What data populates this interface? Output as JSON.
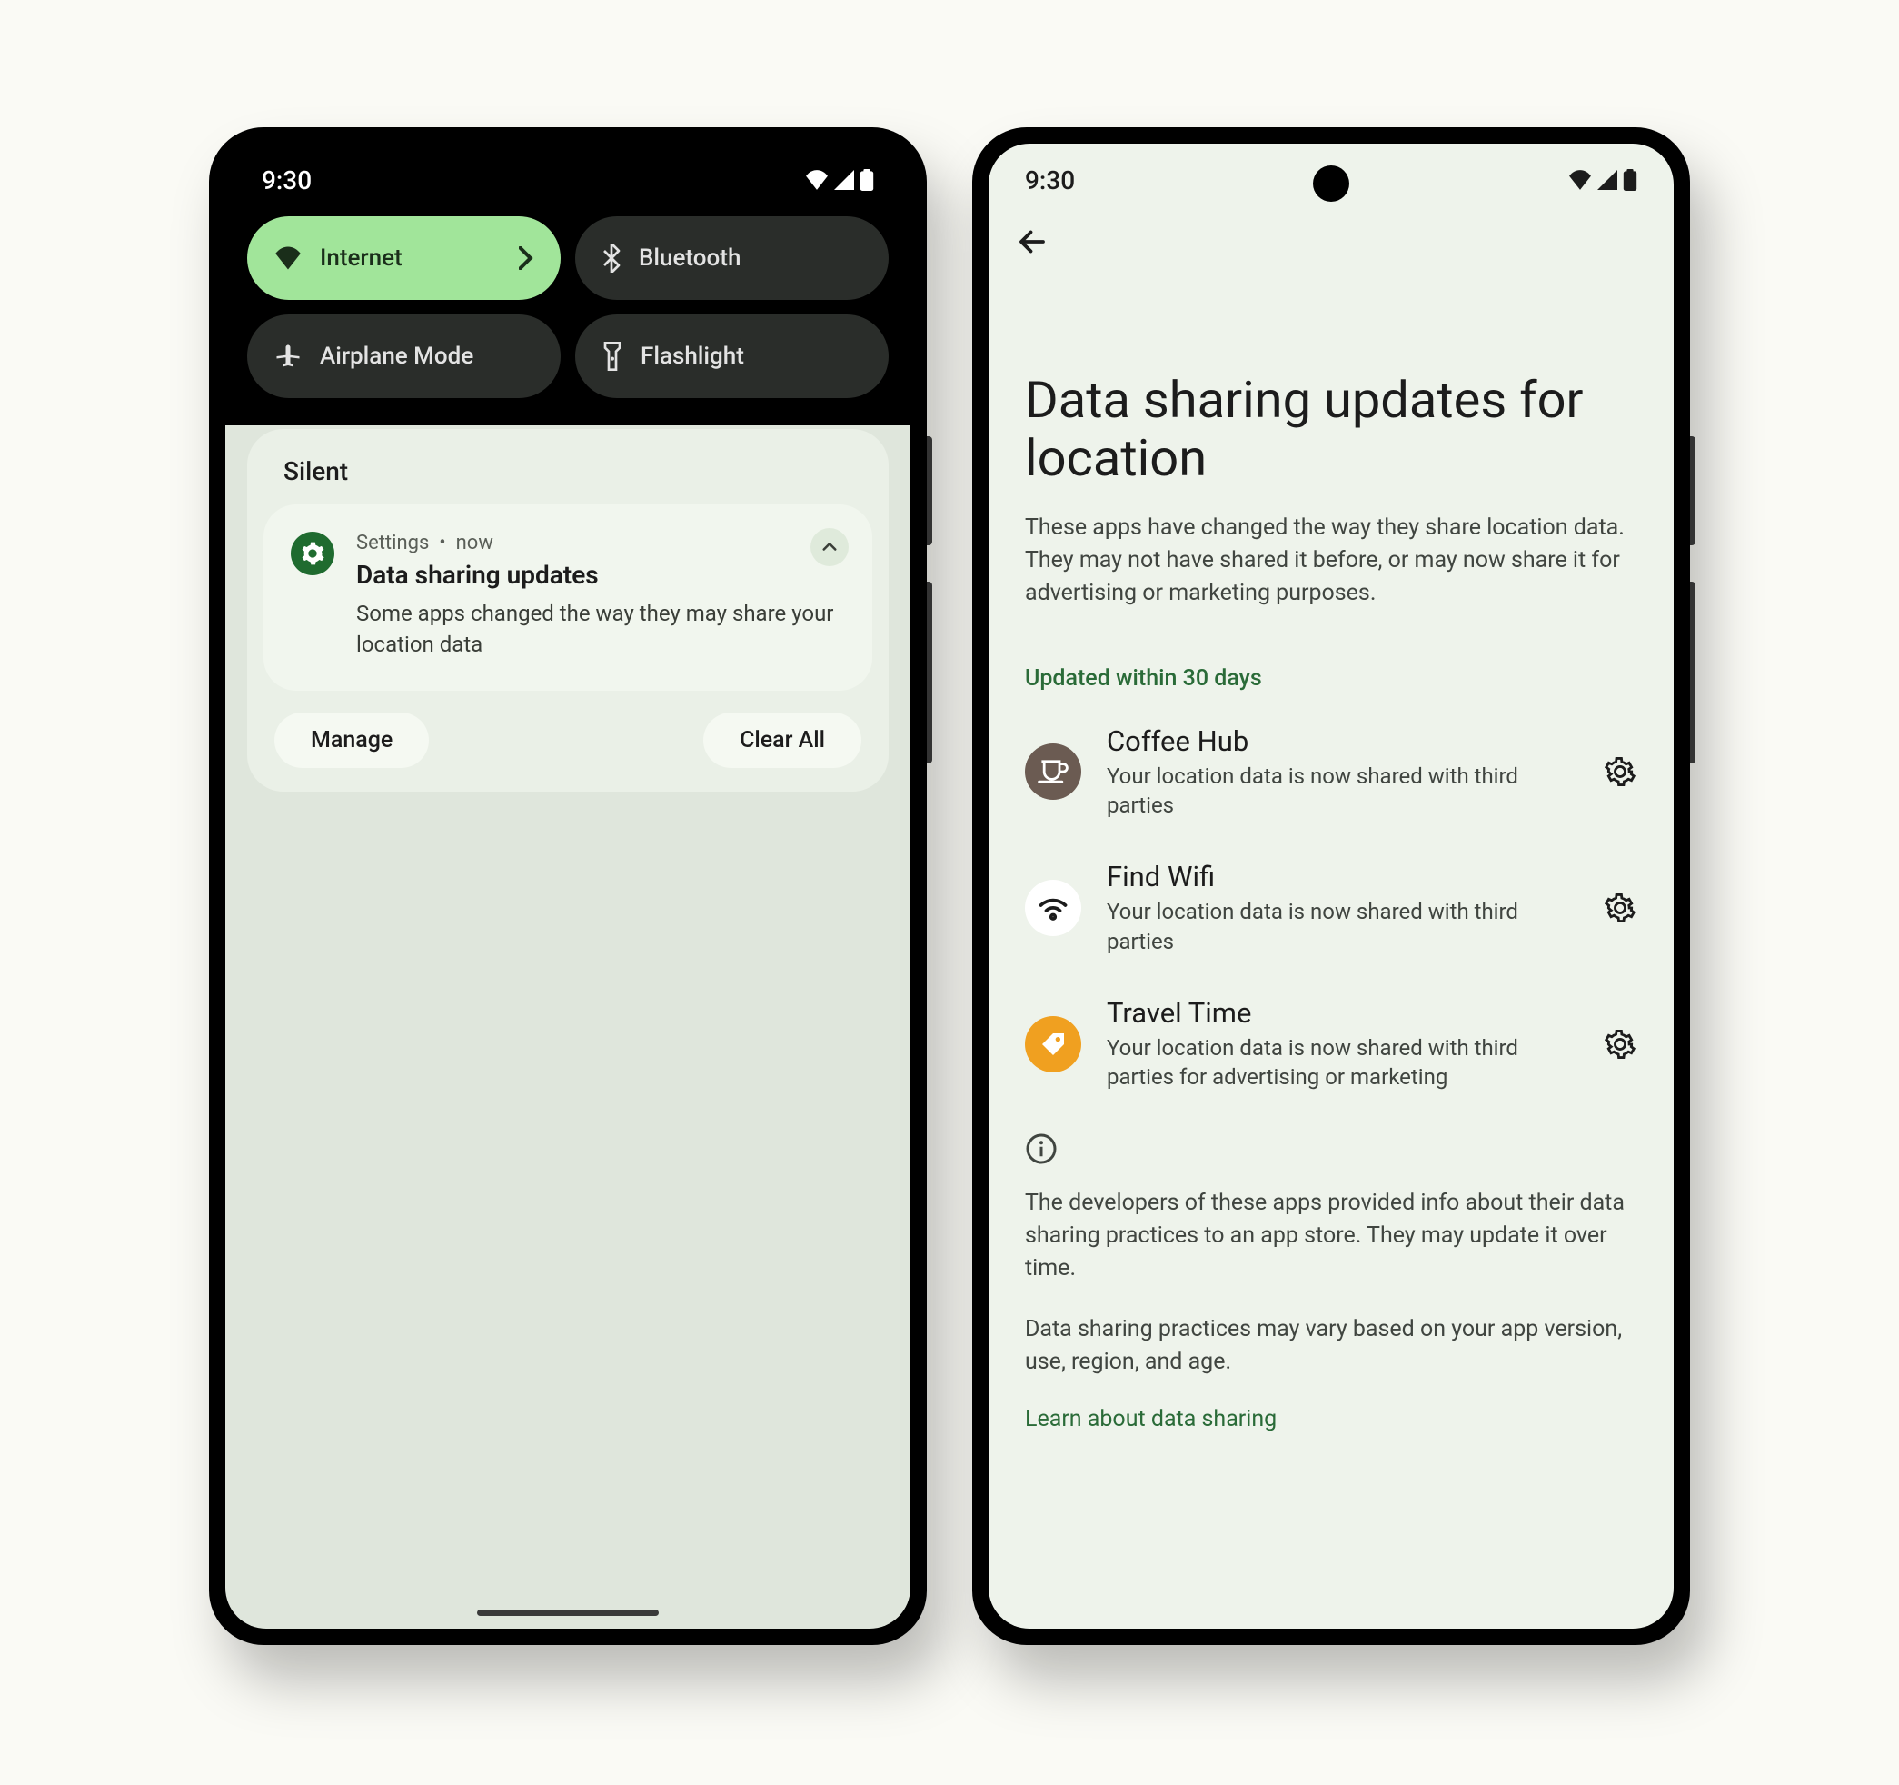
{
  "phone1": {
    "statusTime": "9:30",
    "qs": {
      "internet": "Internet",
      "bluetooth": "Bluetooth",
      "airplane": "Airplane Mode",
      "flashlight": "Flashlight"
    },
    "silentLabel": "Silent",
    "notif": {
      "source": "Settings",
      "time": "now",
      "sep": "•",
      "title": "Data sharing updates",
      "body": "Some apps changed the way they may share your location data"
    },
    "manage": "Manage",
    "clearAll": "Clear All"
  },
  "phone2": {
    "statusTime": "9:30",
    "title": "Data sharing updates for location",
    "subtitle": "These apps have changed the way they share location data. They may not have shared it before, or may now share it for advertising or marketing purposes.",
    "sectionLabel": "Updated within 30 days",
    "apps": [
      {
        "name": "Coffee Hub",
        "desc": "Your location data is now shared with third parties"
      },
      {
        "name": "Find Wifi",
        "desc": "Your location data is now shared with third parties"
      },
      {
        "name": "Travel Time",
        "desc": "Your location data is now shared with third parties for advertising or marketing"
      }
    ],
    "info1": "The developers of these apps provided info about their data sharing practices to an app store. They may update it over time.",
    "info2": "Data sharing practices may vary based on your app version, use, region, and age.",
    "learnLink": "Learn about data sharing"
  }
}
